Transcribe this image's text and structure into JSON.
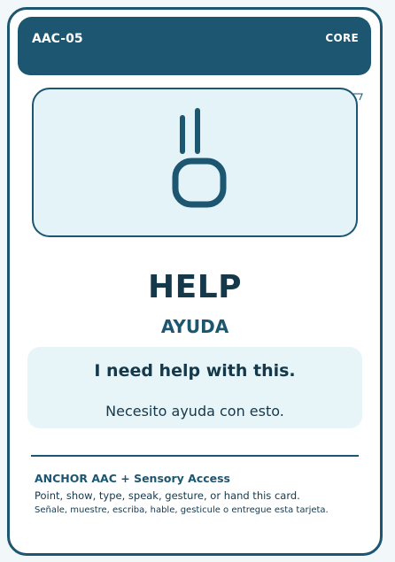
{
  "card": {
    "id": "AAC-05",
    "tag": "CORE",
    "symbol_icon": "help-hand-icon",
    "word_en": "HELP",
    "word_es": "AYUDA",
    "phrase_en": "I need help with this.",
    "phrase_es": "Necesito ayuda con esto."
  },
  "footer": {
    "title": "ANCHOR AAC + Sensory Access",
    "line_en": "Point, show, type, speak, gesture, or hand this card.",
    "line_es": "Señale, muestre, escriba, hable, gesticule o entregue esta tarjeta."
  },
  "colors": {
    "primary": "#1c5670",
    "text_dark": "#15384a",
    "panel": "#e4f3f7",
    "background": "#f2f8fa"
  }
}
